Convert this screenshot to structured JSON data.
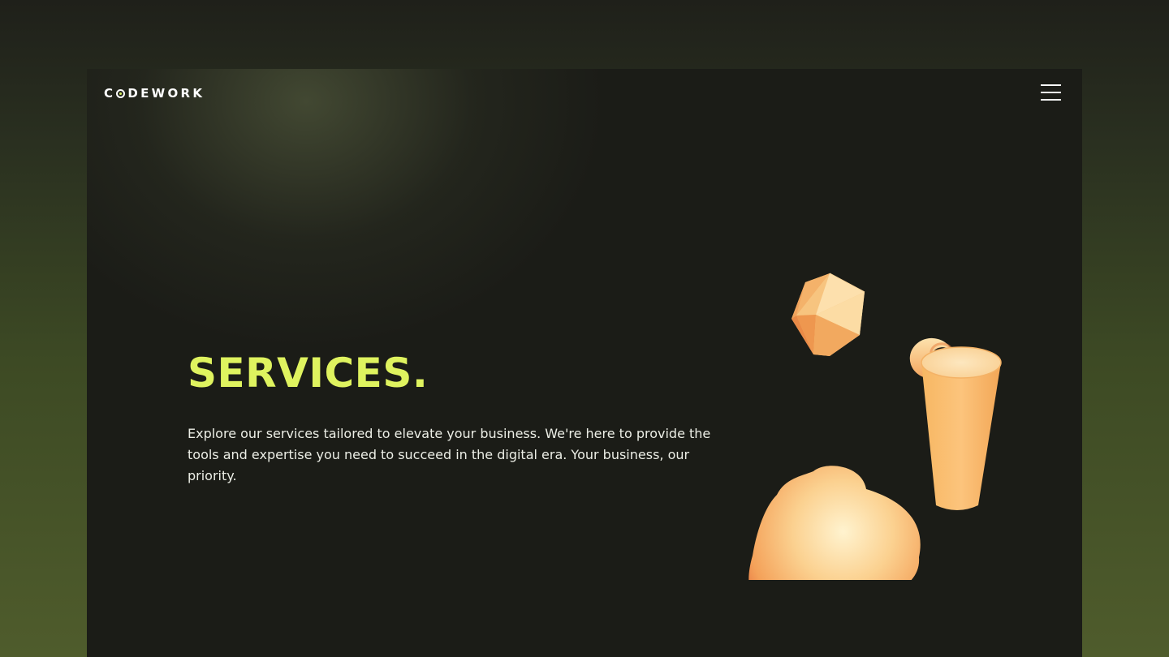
{
  "header": {
    "logo_prefix": "C",
    "logo_suffix": "DEWORK",
    "menu_icon": "hamburger-menu-icon"
  },
  "hero": {
    "title": "SERVICES.",
    "description": "Explore our services tailored to elevate your business. We're here to provide the tools and expertise you need to succeed in the digital era. Your business, our priority."
  },
  "illustration": {
    "shapes": [
      "icosahedron",
      "torus-fragment",
      "cylinder-cup",
      "blob"
    ]
  },
  "colors": {
    "accent": "#dff35f",
    "shape": "#f2b56a",
    "panel": "#1b1c17"
  }
}
